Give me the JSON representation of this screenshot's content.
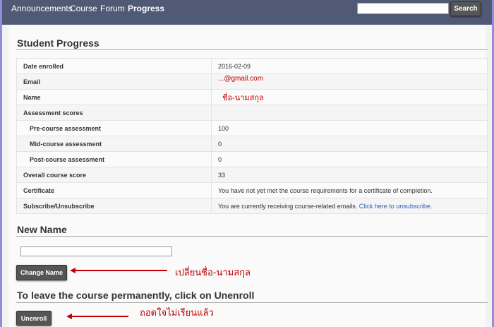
{
  "nav": {
    "items": [
      "Announcements",
      "Course",
      "Forum",
      "Progress"
    ],
    "search_placeholder": "",
    "search_button": "Search"
  },
  "progress": {
    "title": "Student Progress",
    "rows": {
      "date_enrolled": {
        "label": "Date enrolled",
        "value": "2016-02-09"
      },
      "email": {
        "label": "Email",
        "value": "...@gmail.com"
      },
      "name": {
        "label": "Name",
        "value": "ชื่อ-นามสกุล"
      },
      "assessment": {
        "label": "Assessment scores"
      },
      "pre": {
        "label": "Pre-course assessment",
        "value": "100"
      },
      "mid": {
        "label": "Mid-course assessment",
        "value": "0"
      },
      "post": {
        "label": "Post-course assessment",
        "value": "0"
      },
      "overall": {
        "label": "Overall course score",
        "value": "33"
      },
      "certificate": {
        "label": "Certificate",
        "value": "You have not yet met the course requirements for a certificate of completion."
      },
      "subscribe": {
        "label": "Subscribe/Unsubscribe",
        "value": "You are currently receiving course-related emails.",
        "link": "Click here to unsubscribe."
      }
    }
  },
  "new_name": {
    "title": "New Name",
    "input_value": "",
    "button": "Change Name",
    "annotation": "เปลี่ยนชื่อ-นามสกุล"
  },
  "unenroll": {
    "title": "To leave the course permanently, click on Unenroll",
    "button": "Unenroll",
    "annotation": "ถอดใจไม่เรียนแล้ว"
  },
  "colors": {
    "nav_bg": "#505a74",
    "frame": "#8f8fd9",
    "annotation": "#c00000",
    "link": "#2a5db0"
  }
}
